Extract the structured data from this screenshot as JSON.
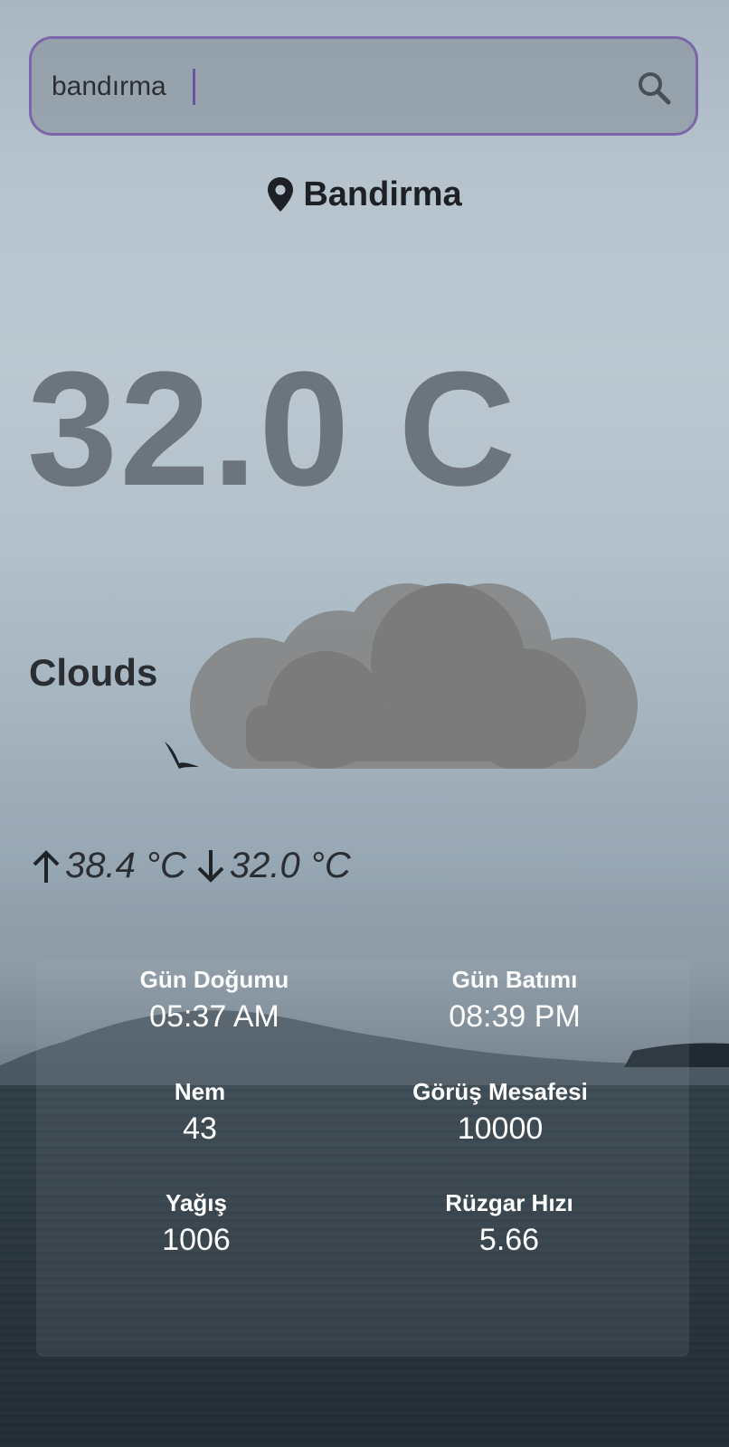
{
  "search": {
    "value": "bandırma",
    "icon": "search-icon"
  },
  "location": {
    "icon": "location-pin-icon",
    "name": "Bandirma"
  },
  "weather": {
    "temperature": "32.0 C",
    "condition": "Clouds",
    "condition_icon": "cloud-icon",
    "max_temp": "38.4 °C",
    "min_temp": "32.0 °C",
    "max_icon": "arrow-up-icon",
    "min_icon": "arrow-down-icon"
  },
  "details": {
    "sunrise": {
      "label": "Gün Doğumu",
      "value": "05:37 AM"
    },
    "sunset": {
      "label": "Gün Batımı",
      "value": "08:39 PM"
    },
    "humidity": {
      "label": "Nem",
      "value": "43"
    },
    "visibility": {
      "label": "Görüş Mesafesi",
      "value": "10000"
    },
    "precipitation": {
      "label": "Yağış",
      "value": "1006"
    },
    "wind_speed": {
      "label": "Rüzgar Hızı",
      "value": "5.66"
    }
  },
  "colors": {
    "search_border": "#7a66a8",
    "temperature_text": "#6c757c",
    "detail_text": "#ffffff"
  }
}
